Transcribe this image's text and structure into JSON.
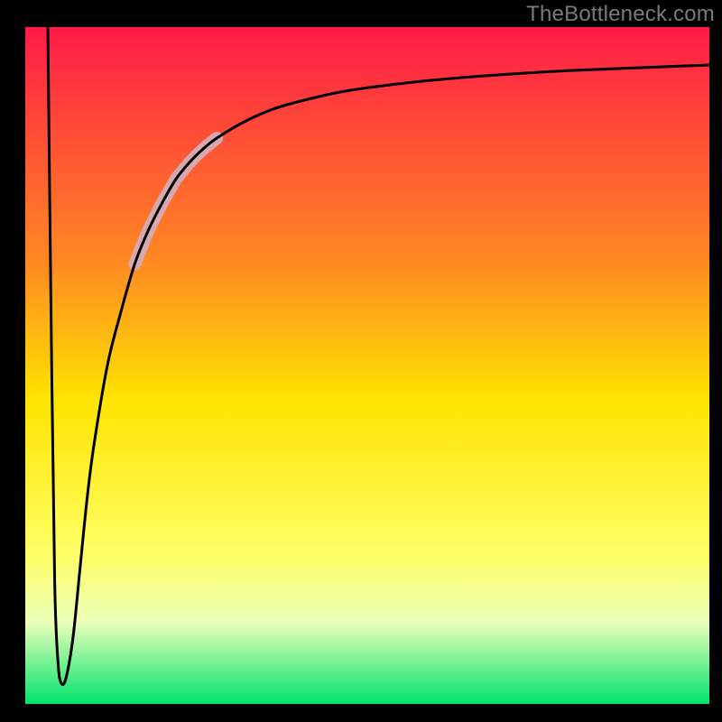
{
  "watermark": "TheBottleneck.com",
  "chart_data": {
    "type": "line",
    "title": "",
    "xlabel": "",
    "ylabel": "",
    "xlim": [
      0,
      100
    ],
    "ylim": [
      0,
      100
    ],
    "background_gradient": {
      "stops": [
        {
          "offset": 0.0,
          "color": "#ff1a47"
        },
        {
          "offset": 0.35,
          "color": "#ff8a22"
        },
        {
          "offset": 0.55,
          "color": "#ffe400"
        },
        {
          "offset": 0.78,
          "color": "#ffff66"
        },
        {
          "offset": 0.88,
          "color": "#eaffba"
        },
        {
          "offset": 1.0,
          "color": "#00e36c"
        }
      ]
    },
    "highlight_segment": {
      "x_start": 16,
      "x_end": 28,
      "color": "#d7a9ae",
      "width": 14
    },
    "series": [
      {
        "name": "curve",
        "x": [
          3.3,
          3.8,
          4.3,
          4.8,
          5.3,
          6.0,
          7.0,
          8.0,
          9.0,
          10,
          12,
          14,
          16,
          18,
          20,
          22,
          24,
          26,
          28,
          32,
          36,
          40,
          46,
          52,
          60,
          70,
          80,
          90,
          100
        ],
        "y": [
          100,
          55,
          18,
          6,
          3,
          4,
          10,
          20,
          30,
          38,
          50,
          58,
          65,
          70,
          74,
          77.5,
          80,
          82,
          83.6,
          86,
          87.8,
          89,
          90.4,
          91.3,
          92.2,
          93,
          93.6,
          94,
          94.4
        ]
      }
    ]
  }
}
